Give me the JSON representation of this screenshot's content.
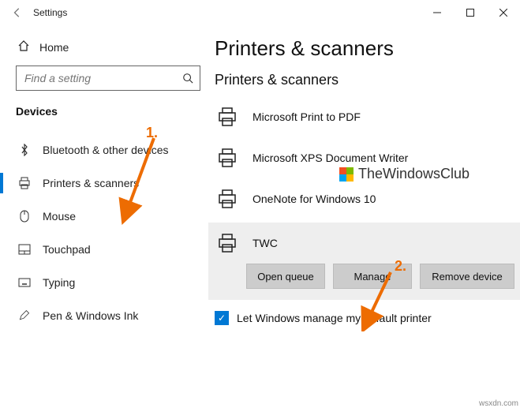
{
  "window": {
    "title": "Settings"
  },
  "home_label": "Home",
  "search": {
    "placeholder": "Find a setting"
  },
  "category": "Devices",
  "nav": [
    {
      "label": "Bluetooth & other devices"
    },
    {
      "label": "Printers & scanners"
    },
    {
      "label": "Mouse"
    },
    {
      "label": "Touchpad"
    },
    {
      "label": "Typing"
    },
    {
      "label": "Pen & Windows Ink"
    }
  ],
  "page": {
    "title": "Printers & scanners",
    "section": "Printers & scanners"
  },
  "devices": [
    {
      "label": "Microsoft Print to PDF"
    },
    {
      "label": "Microsoft XPS Document Writer"
    },
    {
      "label": "OneNote for Windows 10"
    },
    {
      "label": "TWC"
    }
  ],
  "actions": {
    "open": "Open queue",
    "manage": "Manage",
    "remove": "Remove device"
  },
  "checkbox": {
    "label": "Let Windows manage my default printer",
    "checked": true
  },
  "annotations": {
    "one": "1.",
    "two": "2."
  },
  "watermark": "TheWindowsClub",
  "corner": "wsxdn.com"
}
